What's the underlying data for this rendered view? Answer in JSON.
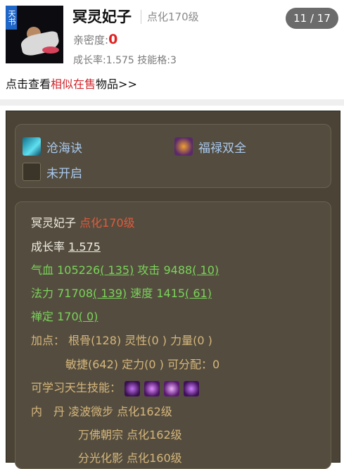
{
  "header": {
    "badge": "天书",
    "pet_name": "冥灵妃子",
    "level": "点化170级",
    "counter": "11 / 17",
    "intimacy_label": "亲密度:",
    "intimacy_value": "0",
    "growth_label": "成长率:1.575",
    "skill_slots_label": "技能格:3"
  },
  "similar": {
    "prefix": "点击查看",
    "link": "相似在售",
    "suffix": "物品>>"
  },
  "skills": [
    {
      "label": "沧海诀",
      "icon": "wave-skill-icon",
      "color": "#35c3d6"
    },
    {
      "label": "福禄双全",
      "icon": "fortune-skill-icon",
      "color": "#c27a2a"
    },
    {
      "label": "未开启",
      "icon": "locked-skill-icon",
      "color": "#6b6452"
    }
  ],
  "detail": {
    "name": "冥灵妃子",
    "level": "点化170级",
    "growth_label": "成长率",
    "growth_value": "1.575",
    "hp_label": "气血",
    "hp_value": "105226",
    "hp_add": "( 135)",
    "atk_label": "攻击",
    "atk_value": "9488",
    "atk_add": "( 10)",
    "mp_label": "法力",
    "mp_value": "71708",
    "mp_add": "( 139)",
    "spd_label": "速度",
    "spd_value": "1415",
    "spd_add": "( 61)",
    "zen_label": "禅定",
    "zen_value": "170",
    "zen_add": "( 0)",
    "points_label": "加点：",
    "gengu": "根骨(128)",
    "lingxing": "灵性(0 )",
    "liliang": "力量(0 )",
    "minjie": "敏捷(642)",
    "dingli": "定力(0 )",
    "kefenpei": "可分配：0",
    "innate_label": "可学习天生技能：",
    "innate_icons": [
      {
        "name": "purple-swirl-icon",
        "color": "#7a2aa8"
      },
      {
        "name": "purple-slash-icon",
        "color": "#9b3bd4"
      },
      {
        "name": "purple-burst-icon",
        "color": "#b04fdc"
      },
      {
        "name": "purple-claw-icon",
        "color": "#8c36c8"
      }
    ],
    "neidan_label": "内　丹",
    "neidan": [
      {
        "name": "凌波微步",
        "level": "点化162级"
      },
      {
        "name": "万佛朝宗",
        "level": "点化162级"
      },
      {
        "name": "分光化影",
        "level": "点化160级"
      }
    ]
  }
}
